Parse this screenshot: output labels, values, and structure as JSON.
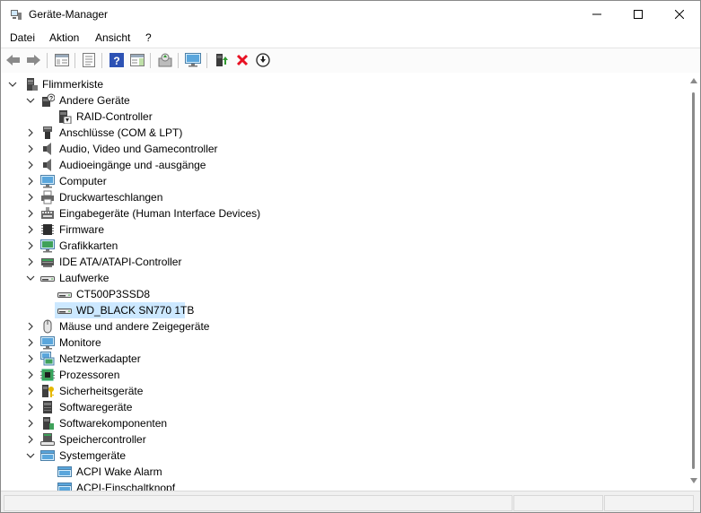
{
  "window": {
    "title": "Geräte-Manager"
  },
  "menu": [
    "Datei",
    "Aktion",
    "Ansicht",
    "?"
  ],
  "toolbar": [
    "back-icon",
    "forward-icon",
    "show-hide-console-tree-icon",
    "properties-icon",
    "help-icon",
    "action-pane-icon",
    "update-driver-icon",
    "scan-hardware-icon",
    "enable-device-icon",
    "uninstall-device-icon",
    "download-driver-icon"
  ],
  "tree": {
    "root": "Flimmerkiste",
    "items": [
      {
        "label": "Andere Geräte",
        "level": 1,
        "expanded": true,
        "icon": "unknown-device-icon"
      },
      {
        "label": "RAID-Controller",
        "level": 2,
        "icon": "warning-device-icon"
      },
      {
        "label": "Anschlüsse (COM & LPT)",
        "level": 1,
        "expanded": false,
        "icon": "port-icon"
      },
      {
        "label": "Audio, Video und Gamecontroller",
        "level": 1,
        "expanded": false,
        "icon": "speaker-icon"
      },
      {
        "label": "Audioeingänge und -ausgänge",
        "level": 1,
        "expanded": false,
        "icon": "speaker-icon"
      },
      {
        "label": "Computer",
        "level": 1,
        "expanded": false,
        "icon": "monitor-icon"
      },
      {
        "label": "Druckwarteschlangen",
        "level": 1,
        "expanded": false,
        "icon": "printer-icon"
      },
      {
        "label": "Eingabegeräte (Human Interface Devices)",
        "level": 1,
        "expanded": false,
        "icon": "hid-icon"
      },
      {
        "label": "Firmware",
        "level": 1,
        "expanded": false,
        "icon": "chip-icon"
      },
      {
        "label": "Grafikkarten",
        "level": 1,
        "expanded": false,
        "icon": "display-adapter-icon"
      },
      {
        "label": "IDE ATA/ATAPI-Controller",
        "level": 1,
        "expanded": false,
        "icon": "ide-controller-icon"
      },
      {
        "label": "Laufwerke",
        "level": 1,
        "expanded": true,
        "icon": "drive-icon"
      },
      {
        "label": "CT500P3SSD8",
        "level": 2,
        "icon": "drive-icon"
      },
      {
        "label": "WD_BLACK SN770 1TB",
        "level": 2,
        "icon": "drive-icon",
        "selected": true
      },
      {
        "label": "Mäuse und andere Zeigegeräte",
        "level": 1,
        "expanded": false,
        "icon": "mouse-icon"
      },
      {
        "label": "Monitore",
        "level": 1,
        "expanded": false,
        "icon": "monitor-icon"
      },
      {
        "label": "Netzwerkadapter",
        "level": 1,
        "expanded": false,
        "icon": "network-icon"
      },
      {
        "label": "Prozessoren",
        "level": 1,
        "expanded": false,
        "icon": "cpu-icon"
      },
      {
        "label": "Sicherheitsgeräte",
        "level": 1,
        "expanded": false,
        "icon": "security-key-icon"
      },
      {
        "label": "Softwaregeräte",
        "level": 1,
        "expanded": false,
        "icon": "software-device-icon"
      },
      {
        "label": "Softwarekomponenten",
        "level": 1,
        "expanded": false,
        "icon": "software-component-icon"
      },
      {
        "label": "Speichercontroller",
        "level": 1,
        "expanded": false,
        "icon": "storage-controller-icon"
      },
      {
        "label": "Systemgeräte",
        "level": 1,
        "expanded": true,
        "icon": "system-device-icon"
      },
      {
        "label": "ACPI Wake Alarm",
        "level": 2,
        "icon": "system-device-icon"
      },
      {
        "label": "ACPI-Einschaltknopf",
        "level": 2,
        "icon": "system-device-icon"
      }
    ]
  },
  "colors": {
    "selection": "#cce8ff",
    "accent": "#0a6fc2",
    "uninstall": "#e81123"
  }
}
